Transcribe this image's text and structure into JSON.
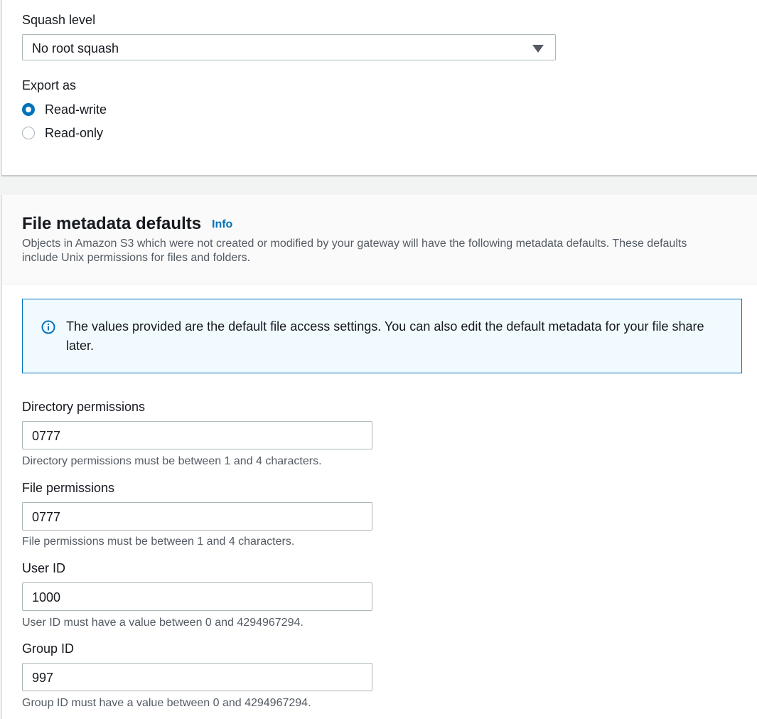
{
  "nfs_settings": {
    "squash_label": "Squash level",
    "squash_value": "No root squash",
    "export_label": "Export as",
    "export_options": [
      "Read-write",
      "Read-only"
    ],
    "export_selected": "Read-write"
  },
  "metadata": {
    "title": "File metadata defaults",
    "info_link": "Info",
    "description": "Objects in Amazon S3 which were not created or modified by your gateway will have the following metadata defaults. These defaults include Unix permissions for files and folders.",
    "alert": "The values provided are the default file access settings. You can also edit the default metadata for your file share later.",
    "fields": [
      {
        "label": "Directory permissions",
        "value": "0777",
        "hint": "Directory permissions must be between 1 and 4 characters."
      },
      {
        "label": "File permissions",
        "value": "0777",
        "hint": "File permissions must be between 1 and 4 characters."
      },
      {
        "label": "User ID",
        "value": "1000",
        "hint": "User ID must have a value between 0 and 4294967294."
      },
      {
        "label": "Group ID",
        "value": "997",
        "hint": "Group ID must have a value between 0 and 4294967294."
      }
    ]
  },
  "colors": {
    "accent": "#0073bb",
    "alert_bg": "#f1faff",
    "border": "#aab7b8"
  }
}
